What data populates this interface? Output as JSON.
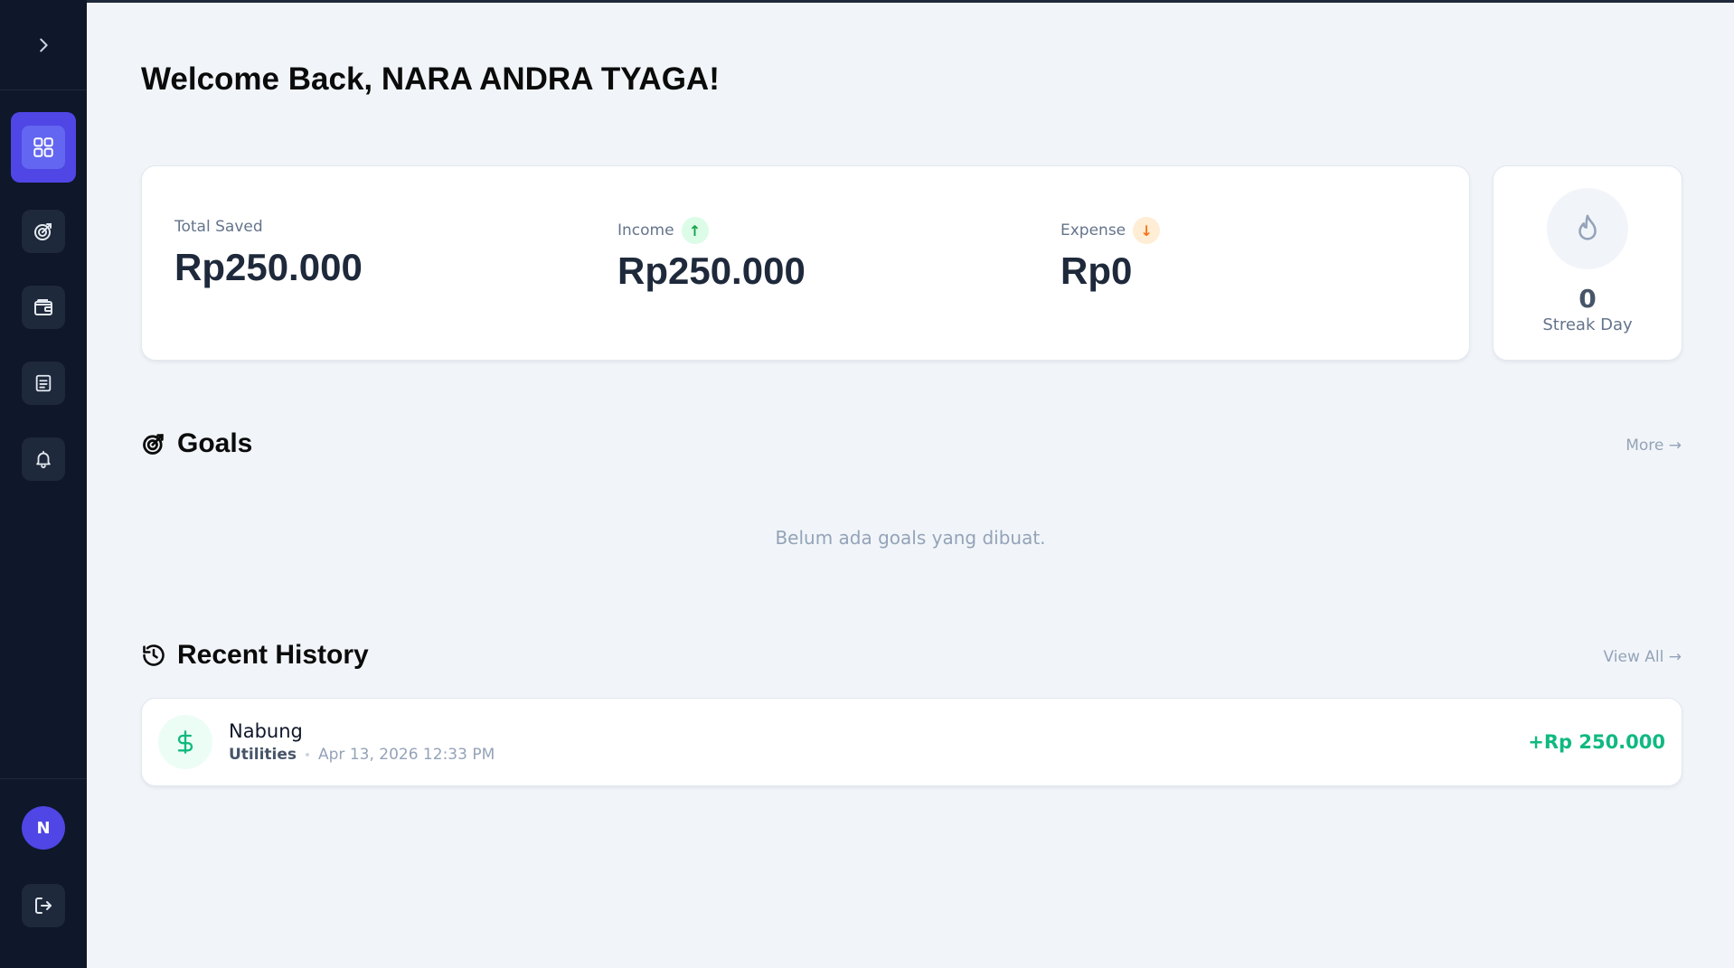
{
  "sidebar": {
    "toggle_icon": "chevron-right-icon",
    "items": [
      {
        "name": "dashboard",
        "icon": "grid-icon",
        "active": true
      },
      {
        "name": "goals",
        "icon": "target-icon",
        "active": false
      },
      {
        "name": "wallet",
        "icon": "wallet-icon",
        "active": false
      },
      {
        "name": "reports",
        "icon": "document-icon",
        "active": false
      },
      {
        "name": "notifications",
        "icon": "bell-icon",
        "active": false
      }
    ],
    "avatar_initial": "N",
    "logout_icon": "logout-icon"
  },
  "header": {
    "welcome": "Welcome Back, NARA ANDRA TYAGA!"
  },
  "stats": {
    "total_saved_label": "Total Saved",
    "total_saved_value": "Rp250.000",
    "income_label": "Income",
    "income_arrow": "↑",
    "income_value": "Rp250.000",
    "expense_label": "Expense",
    "expense_arrow": "↓",
    "expense_value": "Rp0"
  },
  "streak": {
    "count": "0",
    "label": "Streak Day"
  },
  "goals": {
    "title": "Goals",
    "more_label": "More →",
    "empty_message": "Belum ada goals yang dibuat."
  },
  "history": {
    "title": "Recent History",
    "view_all_label": "View All →",
    "items": [
      {
        "title": "Nabung",
        "category": "Utilities",
        "datetime": "Apr 13, 2026 12:33 PM",
        "amount": "+Rp 250.000"
      }
    ]
  },
  "colors": {
    "sidebar_bg": "#0f172a",
    "accent": "#4f46e5",
    "page_bg": "#f1f5f9",
    "positive": "#10b981",
    "expense_badge": "#f97316",
    "income_badge": "#16a34a"
  }
}
